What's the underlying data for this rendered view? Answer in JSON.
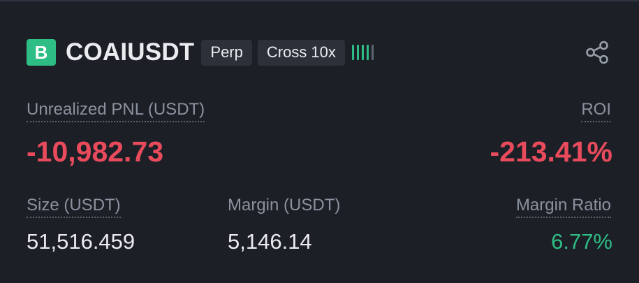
{
  "position": {
    "side_badge": "B",
    "symbol": "COAIUSDT",
    "contract_type": "Perp",
    "margin_mode": "Cross 10x",
    "adl_indicator": {
      "level": 4,
      "max": 5,
      "active_color": "#2ebd85",
      "inactive_color": "#5e6573"
    },
    "share_icon": "share-icon"
  },
  "metrics": {
    "unrealized_pnl_label": "Unrealized PNL (USDT)",
    "unrealized_pnl_value": "-10,982.73",
    "roi_label": "ROI",
    "roi_value": "-213.41%",
    "size_label": "Size (USDT)",
    "size_value": "51,516.459",
    "margin_label": "Margin (USDT)",
    "margin_value": "5,146.14",
    "margin_ratio_label": "Margin Ratio",
    "margin_ratio_value": "6.77%"
  },
  "colors": {
    "background": "#1c2026",
    "negative": "#e94b5d",
    "positive": "#2ebd85",
    "muted_text": "#8b919e",
    "tag_background": "#2b3039"
  }
}
